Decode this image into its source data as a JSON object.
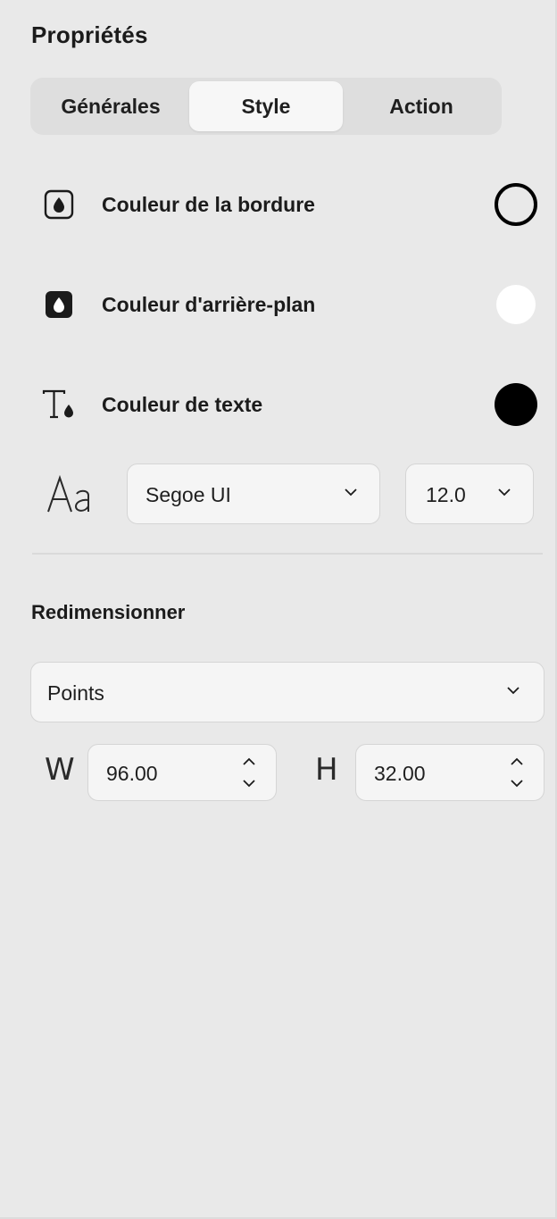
{
  "panel": {
    "title": "Propriétés"
  },
  "tabs": [
    {
      "label": "Générales",
      "active": false
    },
    {
      "label": "Style",
      "active": true
    },
    {
      "label": "Action",
      "active": false
    }
  ],
  "style": {
    "border_color": {
      "label": "Couleur de la bordure",
      "icon": "drop-outline-icon",
      "swatch": "#000000",
      "swatch_style": "ring"
    },
    "background_color": {
      "label": "Couleur d'arrière-plan",
      "icon": "drop-filled-icon",
      "swatch": "#ffffff"
    },
    "text_color": {
      "label": "Couleur de texte",
      "icon": "text-color-icon",
      "swatch": "#000000"
    }
  },
  "font": {
    "icon": "font-aa-icon",
    "family": "Segoe UI",
    "size": "12.0"
  },
  "resize": {
    "title": "Redimensionner",
    "unit": "Points",
    "width_letter": "W",
    "width_value": "96.00",
    "height_letter": "H",
    "height_value": "32.00"
  },
  "colors": {
    "panel_bg": "#e9e9e9",
    "control_bg": "#f5f5f5",
    "tab_track": "#dedede",
    "tab_active": "#f7f7f7",
    "text": "#1b1b1b"
  }
}
